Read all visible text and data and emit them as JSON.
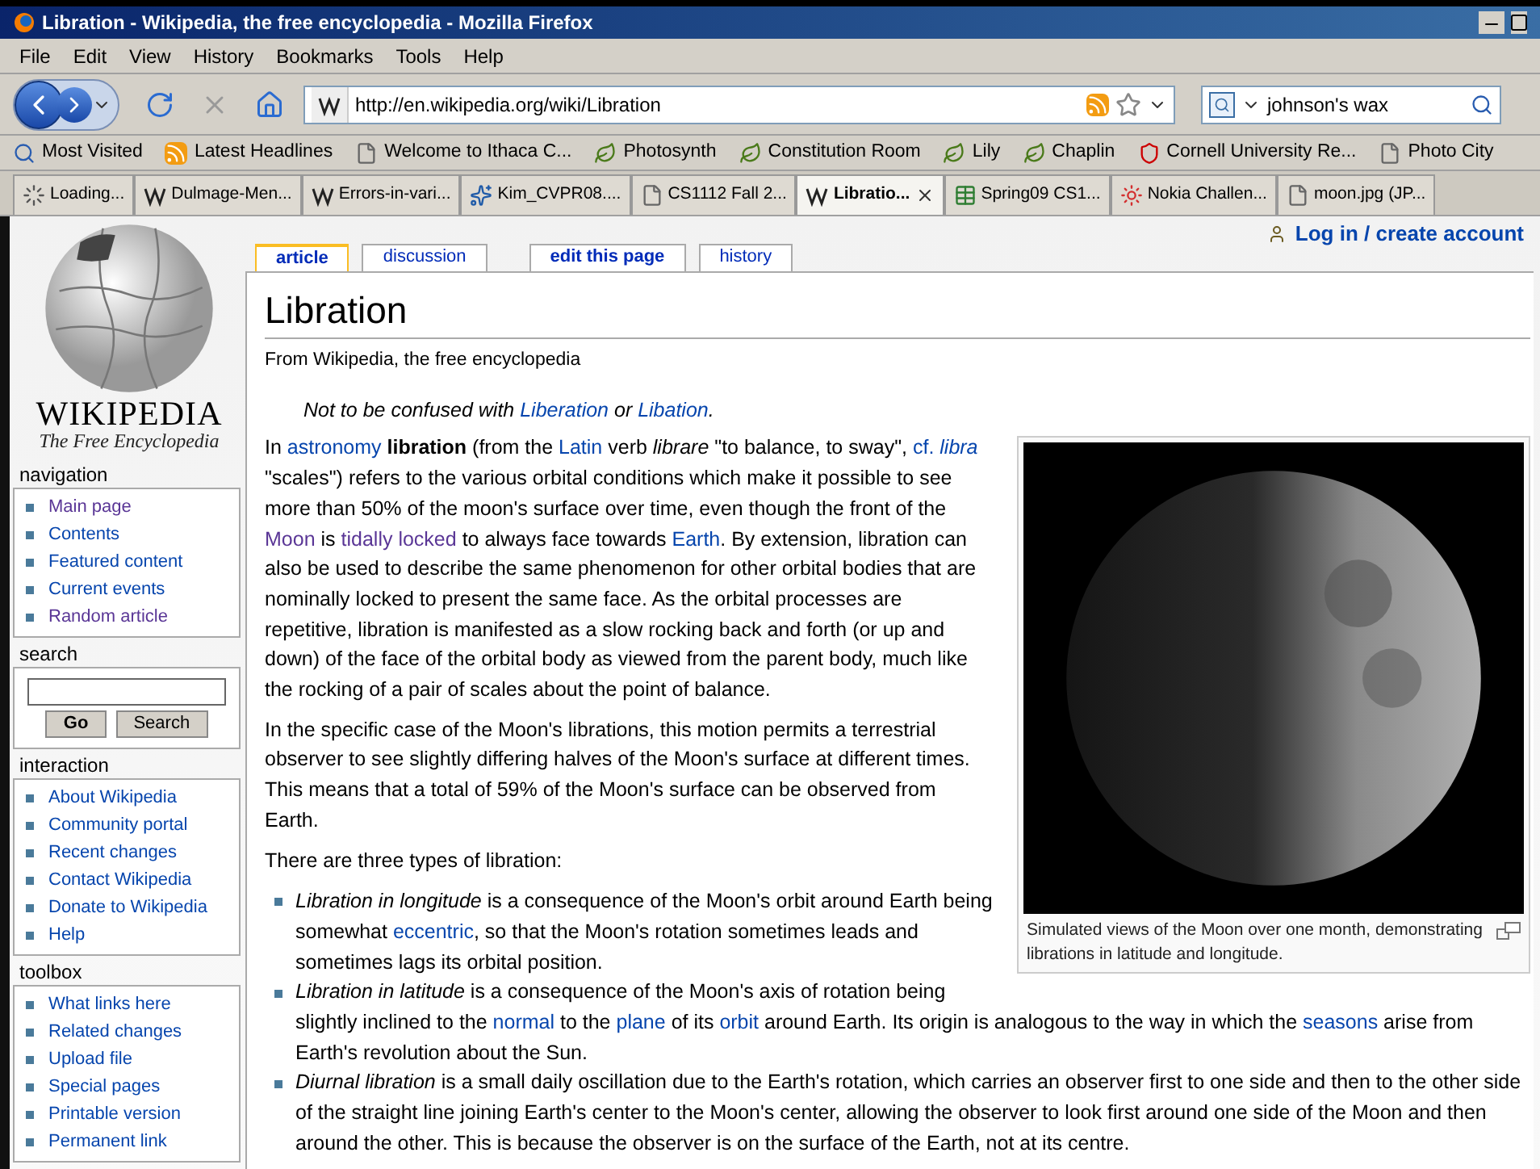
{
  "window": {
    "title": "Libration - Wikipedia, the free encyclopedia - Mozilla Firefox"
  },
  "menu": [
    "File",
    "Edit",
    "View",
    "History",
    "Bookmarks",
    "Tools",
    "Help"
  ],
  "toolbar": {
    "url": "http://en.wikipedia.org/wiki/Libration",
    "search_value": "johnson's wax"
  },
  "bookmarks": [
    {
      "label": "Most Visited",
      "kind": "smart"
    },
    {
      "label": "Latest Headlines",
      "kind": "feed"
    },
    {
      "label": "Welcome to Ithaca C...",
      "kind": "page"
    },
    {
      "label": "Photosynth",
      "kind": "leaf"
    },
    {
      "label": "Constitution Room",
      "kind": "leaf"
    },
    {
      "label": "Lily",
      "kind": "leaf"
    },
    {
      "label": "Chaplin",
      "kind": "leaf"
    },
    {
      "label": "Cornell University Re...",
      "kind": "shield"
    },
    {
      "label": "Photo City",
      "kind": "page"
    }
  ],
  "tabs": [
    {
      "label": "Loading...",
      "kind": "loading",
      "selected": false
    },
    {
      "label": "Dulmage-Men...",
      "kind": "wiki",
      "selected": false
    },
    {
      "label": "Errors-in-vari...",
      "kind": "wiki",
      "selected": false
    },
    {
      "label": "Kim_CVPR08....",
      "kind": "ncsa",
      "selected": false
    },
    {
      "label": "CS1112 Fall 2...",
      "kind": "page",
      "selected": false
    },
    {
      "label": "Libratio...",
      "kind": "wiki",
      "selected": true
    },
    {
      "label": "Spring09 CS1...",
      "kind": "sheet",
      "selected": false
    },
    {
      "label": "Nokia Challen...",
      "kind": "nokia",
      "selected": false
    },
    {
      "label": "moon.jpg (JP...",
      "kind": "page",
      "selected": false
    }
  ],
  "sidebar": {
    "logo": {
      "wordmark": "WIKIPEDIA",
      "tagline": "The Free Encyclopedia"
    },
    "sections": [
      {
        "kind": "links",
        "heading": "navigation",
        "items": [
          {
            "label": "Main page",
            "visited": true
          },
          {
            "label": "Contents",
            "visited": false
          },
          {
            "label": "Featured content",
            "visited": false
          },
          {
            "label": "Current events",
            "visited": false
          },
          {
            "label": "Random article",
            "visited": true
          }
        ]
      },
      {
        "kind": "search",
        "heading": "search",
        "buttons": [
          "Go",
          "Search"
        ]
      },
      {
        "kind": "links",
        "heading": "interaction",
        "items": [
          {
            "label": "About Wikipedia",
            "visited": false
          },
          {
            "label": "Community portal",
            "visited": false
          },
          {
            "label": "Recent changes",
            "visited": false
          },
          {
            "label": "Contact Wikipedia",
            "visited": false
          },
          {
            "label": "Donate to Wikipedia",
            "visited": false
          },
          {
            "label": "Help",
            "visited": false
          }
        ]
      },
      {
        "kind": "links",
        "heading": "toolbox",
        "items": [
          {
            "label": "What links here",
            "visited": false
          },
          {
            "label": "Related changes",
            "visited": false
          },
          {
            "label": "Upload file",
            "visited": false
          },
          {
            "label": "Special pages",
            "visited": false
          },
          {
            "label": "Printable version",
            "visited": false
          },
          {
            "label": "Permanent link",
            "visited": false
          }
        ]
      }
    ]
  },
  "page": {
    "login": "Log in / create account",
    "page_tabs": [
      {
        "label": "article",
        "selected": true
      },
      {
        "label": "discussion",
        "selected": false
      },
      {
        "label": "edit this page",
        "selected": false
      },
      {
        "label": "history",
        "selected": false
      }
    ],
    "title": "Libration",
    "subtitle": "From Wikipedia, the free encyclopedia",
    "hatnote": [
      {
        "t": "Not to be confused with "
      },
      {
        "t": "Liberation",
        "link": true,
        "visited": false
      },
      {
        "t": " or "
      },
      {
        "t": "Libation",
        "link": true,
        "visited": false
      },
      {
        "t": "."
      }
    ],
    "figure": {
      "caption": "Simulated views of the Moon over one month, demonstrating librations in latitude and longitude."
    },
    "paragraphs": [
      [
        {
          "t": "In "
        },
        {
          "t": "astronomy",
          "link": true,
          "visited": false
        },
        {
          "t": " **libration** (from the "
        },
        {
          "t": "Latin",
          "link": true,
          "visited": false
        },
        {
          "t": " verb *librare* \"to balance, to sway\", "
        },
        {
          "t": "cf. ",
          "link": true,
          "visited": false
        },
        {
          "t": "*libra*",
          "link": true,
          "visited": false
        },
        {
          "t": " \"scales\") refers to the various orbital conditions which make it possible to see more than 50% of the moon's surface over time, even though the front of the "
        },
        {
          "t": "Moon",
          "link": true,
          "visited": true
        },
        {
          "t": " is "
        },
        {
          "t": "tidally locked",
          "link": true,
          "visited": true
        },
        {
          "t": " to always face towards "
        },
        {
          "t": "Earth",
          "link": true,
          "visited": false
        },
        {
          "t": ". By extension, libration can also be used to describe the same phenomenon for other orbital bodies that are nominally locked to present the same face. As the orbital processes are repetitive, libration is manifested as a slow rocking back and forth (or up and down) of the face of the orbital body as viewed from the parent body, much like the rocking of a pair of scales about the point of balance."
        }
      ],
      [
        {
          "t": "In the specific case of the Moon's librations, this motion permits a terrestrial observer to see slightly differing halves of the Moon's surface at different times. This means that a total of 59% of the Moon's surface can be observed from Earth."
        }
      ],
      [
        {
          "t": "There are three types of libration:"
        }
      ]
    ],
    "bullets": [
      [
        {
          "t": "*Libration in longitude* is a consequence of the Moon's orbit around Earth being somewhat "
        },
        {
          "t": "eccentric",
          "link": true,
          "visited": false
        },
        {
          "t": ", so that the Moon's rotation sometimes leads and sometimes lags its orbital position."
        }
      ],
      [
        {
          "t": "*Libration in latitude* is a consequence of the Moon's axis of rotation being slightly inclined to the "
        },
        {
          "t": "normal",
          "link": true,
          "visited": false
        },
        {
          "t": " to the "
        },
        {
          "t": "plane",
          "link": true,
          "visited": false
        },
        {
          "t": " of its "
        },
        {
          "t": "orbit",
          "link": true,
          "visited": false
        },
        {
          "t": " around Earth. Its origin is analogous to the way in which the "
        },
        {
          "t": "seasons",
          "link": true,
          "visited": false
        },
        {
          "t": " arise from Earth's revolution about the Sun."
        }
      ],
      [
        {
          "t": "*Diurnal libration* is a small daily oscillation due to the Earth's rotation, which carries an observer first to one side and then to the other side of the straight line joining Earth's center to the Moon's center, allowing the observer to look first around one side of the Moon and then around the other. This is because the observer is on the surface of the Earth, not at its centre."
        }
      ]
    ]
  }
}
